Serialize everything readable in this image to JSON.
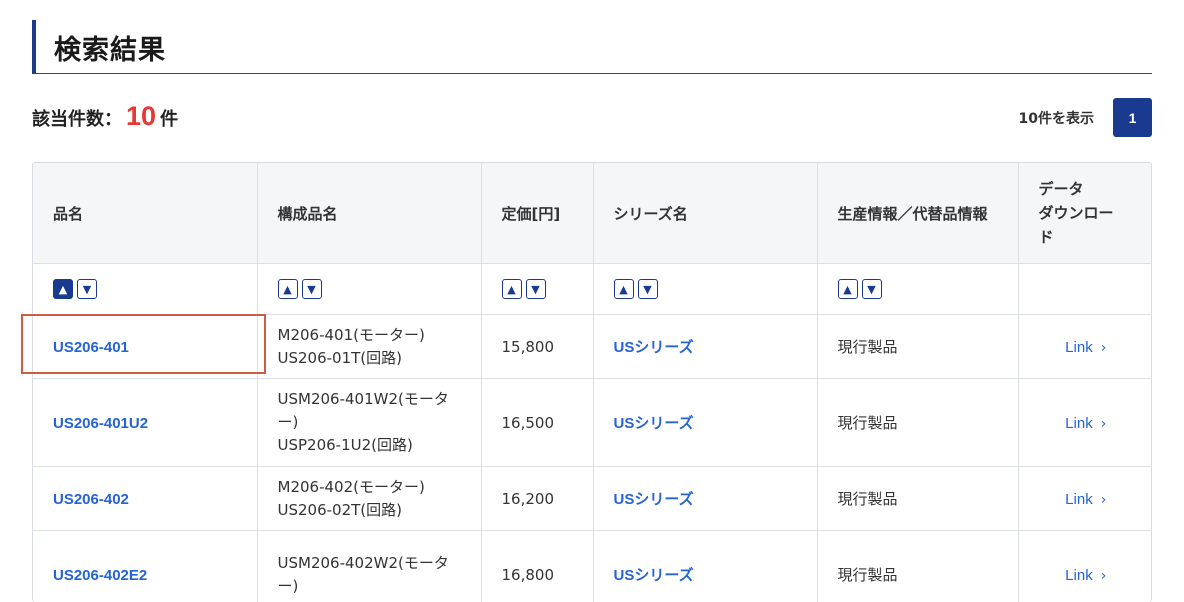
{
  "page_title": "検索結果",
  "result_count": {
    "label": "該当件数：",
    "value": "10",
    "unit": "件"
  },
  "per_page_label": "10件を表示",
  "pagination": {
    "current_page": "1"
  },
  "table": {
    "headers": [
      "品名",
      "構成品名",
      "定価[円]",
      "シリーズ名",
      "生産情報／代替品情報",
      "データダウンロード"
    ],
    "header_download_lines": [
      "データ",
      "ダウンロー",
      "ド"
    ],
    "sortable_columns": [
      0,
      1,
      2,
      3,
      4
    ],
    "active_sort": {
      "column": 0,
      "direction": "asc"
    },
    "sort_up_icon": "triangle-up-icon",
    "sort_down_icon": "triangle-down-icon",
    "rows": [
      {
        "name": "US206-401",
        "components": [
          "M206-401(モーター)",
          "US206-01T(回路)"
        ],
        "price": "15,800",
        "series": "USシリーズ",
        "status": "現行製品",
        "download": "Link"
      },
      {
        "name": "US206-401U2",
        "components": [
          "USM206-401W2(モータ",
          "ー)",
          "USP206-1U2(回路)"
        ],
        "price": "16,500",
        "series": "USシリーズ",
        "status": "現行製品",
        "download": "Link"
      },
      {
        "name": "US206-402",
        "components": [
          "M206-402(モーター)",
          "US206-02T(回路)"
        ],
        "price": "16,200",
        "series": "USシリーズ",
        "status": "現行製品",
        "download": "Link"
      },
      {
        "name": "US206-402E2",
        "components": [
          "USM206-402W2(モータ",
          "ー)"
        ],
        "price": "16,800",
        "series": "USシリーズ",
        "status": "現行製品",
        "download": "Link"
      }
    ]
  },
  "colors": {
    "accent": "#1a3a8f",
    "link": "#2563d6",
    "count_highlight": "#e53935",
    "selection_outline": "#cd5c45"
  }
}
